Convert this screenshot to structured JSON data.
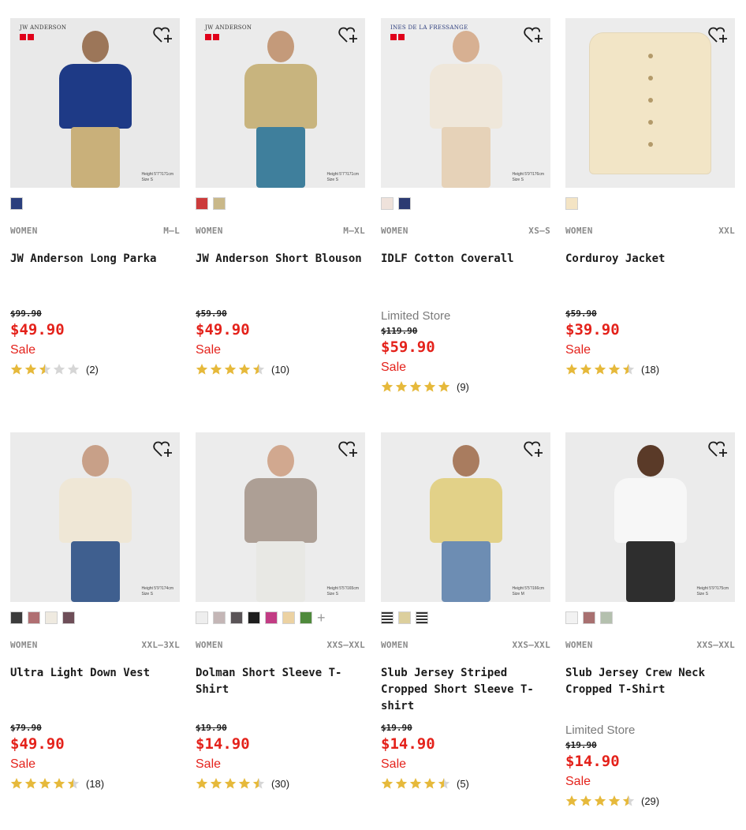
{
  "products": [
    {
      "brand_label": "JW ANDERSON",
      "size_note": [
        "Height 5'7\"/171cm",
        "Size S"
      ],
      "swatches": [
        "#2b3f7d"
      ],
      "category": "WOMEN",
      "sizes": "M–L",
      "name": "JW Anderson Long Parka",
      "limited": "",
      "original_price": "$99.90",
      "price": "$49.90",
      "sale": "Sale",
      "rating": 2.5,
      "reviews": "(2)",
      "figure": {
        "bg": "#e9e9e9",
        "top": "#1e3a86",
        "bottom": "#c9b07a",
        "skin": "#9c7659"
      }
    },
    {
      "brand_label": "JW ANDERSON",
      "size_note": [
        "Height 5'7\"/171cm",
        "Size S"
      ],
      "swatches": [
        "#cc3b3b",
        "#c9b889"
      ],
      "category": "WOMEN",
      "sizes": "M–XL",
      "name": "JW Anderson Short Blouson",
      "limited": "",
      "original_price": "$59.90",
      "price": "$49.90",
      "sale": "Sale",
      "rating": 4.5,
      "reviews": "(10)",
      "figure": {
        "bg": "#ebebeb",
        "top": "#c8b47e",
        "bottom": "#3f7f9c",
        "skin": "#c49a7a"
      }
    },
    {
      "brand_label": "INES DE LA FRESSANGE",
      "size_note": [
        "Height 5'9\"/176cm",
        "Size S"
      ],
      "swatches": [
        "#efe2db",
        "#2c3b72"
      ],
      "category": "WOMEN",
      "sizes": "XS–S",
      "name": "IDLF Cotton Coverall",
      "limited": "Limited Store",
      "original_price": "$119.90",
      "price": "$59.90",
      "sale": "Sale",
      "rating": 5,
      "reviews": "(9)",
      "figure": {
        "bg": "#ededed",
        "top": "#efe7da",
        "bottom": "#e6d2b8",
        "skin": "#d7b092"
      }
    },
    {
      "brand_label": "",
      "size_note": [],
      "swatches": [
        "#f4e4c4"
      ],
      "category": "WOMEN",
      "sizes": "XXL",
      "name": "Corduroy Jacket",
      "limited": "",
      "original_price": "$59.90",
      "price": "$39.90",
      "sale": "Sale",
      "rating": 4.5,
      "reviews": "(18)",
      "figure": {
        "bg": "#ececec",
        "top": "#f2e5c6",
        "bottom": "#f2e5c6",
        "skin": "none"
      }
    },
    {
      "brand_label": "",
      "size_note": [
        "Height 5'9\"/174cm",
        "Size S"
      ],
      "swatches": [
        "#3c3c3c",
        "#b06f72",
        "#efeae0",
        "#6e4e58"
      ],
      "category": "WOMEN",
      "sizes": "XXL–3XL",
      "name": "Ultra Light Down Vest",
      "limited": "",
      "original_price": "$79.90",
      "price": "$49.90",
      "sale": "Sale",
      "rating": 4.5,
      "reviews": "(18)",
      "figure": {
        "bg": "#ebebeb",
        "top": "#efe7d6",
        "bottom": "#3f5f8f",
        "skin": "#c8a088"
      }
    },
    {
      "brand_label": "",
      "size_note": [
        "Height 5'5\"/165cm",
        "Size S"
      ],
      "swatches": [
        "#eeeeee",
        "#c4b6b6",
        "#5a5457",
        "#1e1e1e",
        "#c23c84",
        "#ecd2a2",
        "#4f8a3c"
      ],
      "plus": "+",
      "category": "WOMEN",
      "sizes": "XXS–XXL",
      "name": "Dolman Short Sleeve T-Shirt",
      "limited": "",
      "original_price": "$19.90",
      "price": "$14.90",
      "sale": "Sale",
      "rating": 4.5,
      "reviews": "(30)",
      "figure": {
        "bg": "#ececec",
        "top": "#ad9f95",
        "bottom": "#e8e8e4",
        "skin": "#d1a88f"
      }
    },
    {
      "brand_label": "",
      "size_note": [
        "Height 5'5\"/166cm",
        "Size M"
      ],
      "swatches": [
        "striped",
        "#dccf9d",
        "striped"
      ],
      "category": "WOMEN",
      "sizes": "XXS–XXL",
      "name": "Slub Jersey Striped Cropped Short Sleeve T-shirt",
      "limited": "",
      "original_price": "$19.90",
      "price": "$14.90",
      "sale": "Sale",
      "rating": 4.5,
      "reviews": "(5)",
      "figure": {
        "bg": "#ececec",
        "top": "#e2d188",
        "bottom": "#6d8db3",
        "skin": "#a97c5f"
      }
    },
    {
      "brand_label": "",
      "size_note": [
        "Height 5'9\"/175cm",
        "Size S"
      ],
      "swatches": [
        "#f2f2f2",
        "#a87070",
        "#b4c0ae"
      ],
      "category": "WOMEN",
      "sizes": "XXS–XXL",
      "name": "Slub Jersey Crew Neck Cropped T-Shirt",
      "limited": "Limited Store",
      "original_price": "$19.90",
      "price": "$14.90",
      "sale": "Sale",
      "rating": 4.5,
      "reviews": "(29)",
      "figure": {
        "bg": "#ebebeb",
        "top": "#f7f7f7",
        "bottom": "#2e2e2e",
        "skin": "#5a3a28"
      }
    }
  ],
  "colors": {
    "sale": "#e4221b",
    "star": "#e6b93b",
    "star_empty": "#d6d6d6"
  }
}
